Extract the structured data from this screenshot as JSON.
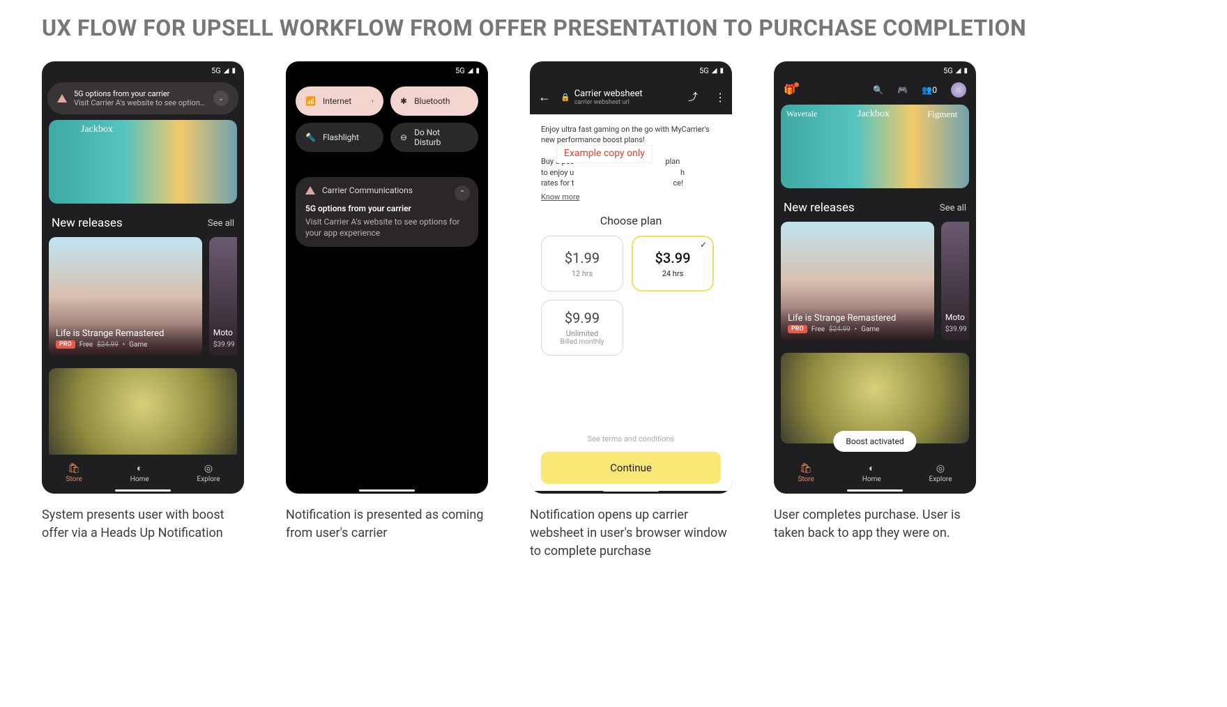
{
  "page_title": "UX FLOW FOR UPSELL WORKFLOW FROM OFFER PRESENTATION TO PURCHASE COMPLETION",
  "status": {
    "network": "5G",
    "signal": "◢",
    "battery": "▮"
  },
  "captions": {
    "s1": "System presents user with boost offer via a Heads Up Notification",
    "s2": "Notification is presented as coming from user's carrier",
    "s3": "Notification opens up carrier websheet in user's browser window to complete purchase",
    "s4": "User completes purchase. User is taken back to app they were on."
  },
  "hun": {
    "title": "5G options from your carrier",
    "subtitle": "Visit Carrier A's website to see options..."
  },
  "store": {
    "hero_label": "Jackbox",
    "new_releases": "New releases",
    "see_all": "See all",
    "card_main": {
      "title": "Life is Strange Remastered",
      "badge": "PRO",
      "free": "Free",
      "old_price": "$24.99",
      "category": "Game"
    },
    "card_side": {
      "title_partial": "Moto",
      "price": "$39.99"
    },
    "nav": {
      "store": "Store",
      "home": "Home",
      "explore": "Explore"
    }
  },
  "qs": {
    "internet": "Internet",
    "bluetooth": "Bluetooth",
    "flashlight": "Flashlight",
    "dnd": "Do Not Disturb"
  },
  "notif": {
    "app": "Carrier Communications",
    "title": "5G options from your carrier",
    "body": "Visit Carrier A's website to see options for your app experience"
  },
  "websheet": {
    "title": "Carrier websheet",
    "url": "carrier websheet url",
    "copy_line1": "Enjoy ultra fast gaming on the go with MyCarrier's new performance boost plans!",
    "copy_line2_a": "Buy a pas",
    "copy_line2_b": "plan",
    "copy_line3_a": "to enjoy u",
    "copy_line3_b": "h",
    "copy_line4_a": "rates for t",
    "copy_line4_b": "ce!",
    "example_label": "Example copy only",
    "know_more": "Know more",
    "choose": "Choose plan",
    "plans": {
      "p1": {
        "price": "$1.99",
        "duration": "12 hrs"
      },
      "p2": {
        "price": "$3.99",
        "duration": "24 hrs"
      },
      "p3": {
        "price": "$9.99",
        "duration": "Unlimited",
        "billing": "Billed monthly"
      }
    },
    "terms": "See terms and conditions",
    "continue": "Continue"
  },
  "toast": {
    "text": "Boost activated"
  },
  "store4": {
    "hero_label_left": "Wavetale",
    "hero_label_mid": "Jackbox",
    "hero_label_right": "Figment",
    "friends": "0"
  }
}
